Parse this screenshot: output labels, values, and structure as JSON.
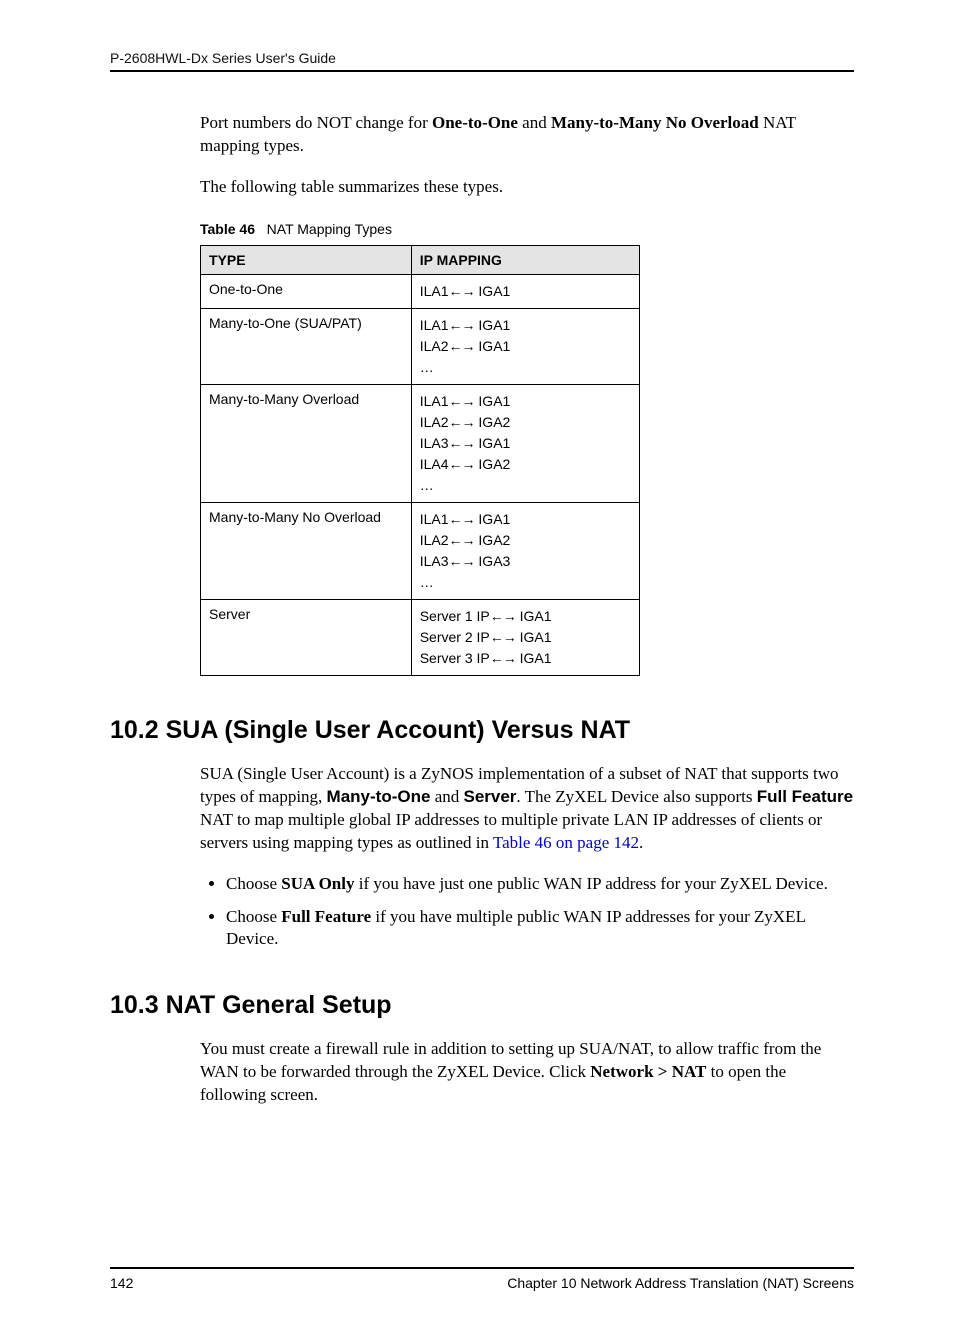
{
  "header": {
    "running": "P-2608HWL-Dx Series User's Guide"
  },
  "intro": {
    "p1_a": "Port numbers do NOT change for ",
    "p1_b": "One-to-One",
    "p1_c": " and ",
    "p1_d": "Many-to-Many No Overload",
    "p1_e": " NAT mapping types.",
    "p2": "The following table summarizes these types."
  },
  "table": {
    "caption_label": "Table 46",
    "caption_text": "NAT Mapping Types",
    "col_type": "TYPE",
    "col_map": "IP MAPPING",
    "rows": [
      {
        "type": "One-to-One",
        "lines": [
          {
            "l": "ILA1",
            "r": "IGA1"
          }
        ],
        "ellipsis": false
      },
      {
        "type": "Many-to-One (SUA/PAT)",
        "lines": [
          {
            "l": "ILA1",
            "r": "IGA1"
          },
          {
            "l": "ILA2",
            "r": "IGA1"
          }
        ],
        "ellipsis": true
      },
      {
        "type": "Many-to-Many Overload",
        "lines": [
          {
            "l": "ILA1",
            "r": "IGA1"
          },
          {
            "l": "ILA2",
            "r": "IGA2"
          },
          {
            "l": "ILA3",
            "r": "IGA1"
          },
          {
            "l": "ILA4",
            "r": "IGA2"
          }
        ],
        "ellipsis": true
      },
      {
        "type": "Many-to-Many No Overload",
        "lines": [
          {
            "l": "ILA1",
            "r": "IGA1"
          },
          {
            "l": "ILA2",
            "r": "IGA2"
          },
          {
            "l": "ILA3",
            "r": "IGA3"
          }
        ],
        "ellipsis": true
      },
      {
        "type": "Server",
        "lines": [
          {
            "l": "Server 1 IP",
            "r": "IGA1"
          },
          {
            "l": "Server 2 IP",
            "r": "IGA1"
          },
          {
            "l": "Server 3 IP",
            "r": "IGA1"
          }
        ],
        "ellipsis": false
      }
    ]
  },
  "sec102": {
    "heading": "10.2  SUA (Single User Account) Versus NAT",
    "p_a": "SUA (Single User Account) is a ZyNOS implementation of a subset of NAT that supports two types of mapping, ",
    "p_b": "Many-to-One",
    "p_c": " and ",
    "p_d": "Server",
    "p_e": ". The ZyXEL Device also supports ",
    "p_f": "Full Feature",
    "p_g": " NAT to map multiple global IP addresses to multiple private LAN IP addresses of clients or servers using mapping types as outlined in ",
    "p_link": "Table 46 on page 142",
    "p_h": ".",
    "bullet1_a": "Choose ",
    "bullet1_b": "SUA Only",
    "bullet1_c": " if you have just one public WAN IP address for your ZyXEL Device.",
    "bullet2_a": "Choose ",
    "bullet2_b": "Full Feature",
    "bullet2_c": " if you have multiple public WAN IP addresses for your ZyXEL Device."
  },
  "sec103": {
    "heading": "10.3  NAT General Setup",
    "p_a": "You must create a firewall rule in addition to setting up SUA/NAT, to allow traffic from the WAN to be forwarded through the ZyXEL Device. Click ",
    "p_b": "Network > NAT",
    "p_c": " to open the following screen."
  },
  "footer": {
    "page": "142",
    "chapter": "Chapter 10 Network Address Translation (NAT) Screens"
  },
  "glyphs": {
    "arrow": "←→",
    "ellipsis": "…"
  }
}
